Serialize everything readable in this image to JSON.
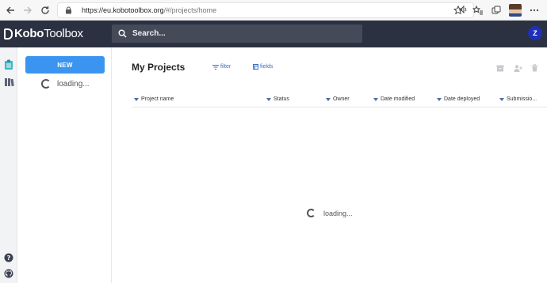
{
  "browser": {
    "url_host": "https://eu.kobotoolbox.org",
    "url_path": "/#/projects/home"
  },
  "header": {
    "logo_bold": "Kobo",
    "logo_light": "Toolbox",
    "search_placeholder": "Search...",
    "user_initial": "Z"
  },
  "sidebar": {
    "new_label": "NEW",
    "loading_text": "loading..."
  },
  "main": {
    "title": "My Projects",
    "filter_label": "filter",
    "fields_label": "fields",
    "columns": [
      "Project name",
      "Status",
      "Owner",
      "Date modified",
      "Date deployed",
      "Submissio..."
    ],
    "loading_text": "loading..."
  },
  "colors": {
    "header_bg": "#2b3140",
    "accent": "#3b95f0",
    "user_badge": "#1e2fb8"
  }
}
